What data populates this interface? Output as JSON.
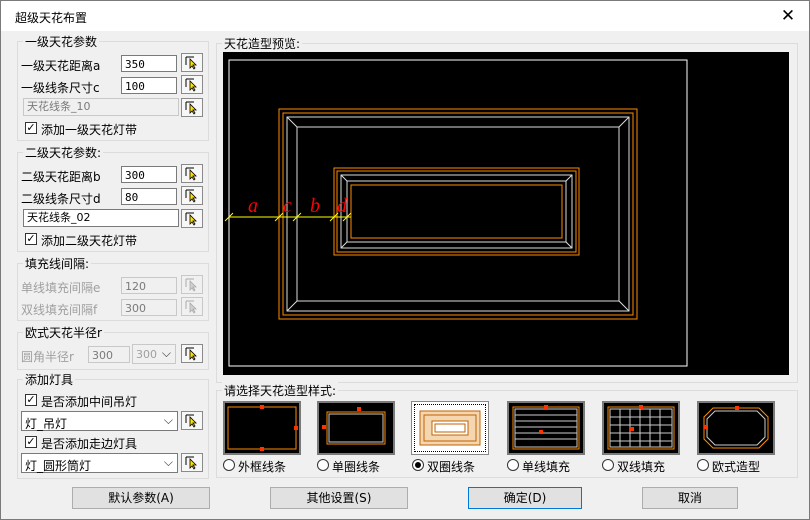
{
  "window": {
    "title": "超级天花布置",
    "close_glyph": "✕"
  },
  "level1": {
    "title": "一级天花参数",
    "distance_label": "一级天花距离a",
    "distance_value": "350",
    "size_label": "一级线条尺寸c",
    "size_value": "100",
    "line_style": "天花线条_10",
    "light_strip_label": "添加一级天花灯带",
    "light_strip_checked": true
  },
  "level2": {
    "title": "二级天花参数:",
    "distance_label": "二级天花距离b",
    "distance_value": "300",
    "size_label": "二级线条尺寸d",
    "size_value": "80",
    "line_style": "天花线条_02",
    "light_strip_label": "添加二级天花灯带",
    "light_strip_checked": true
  },
  "fill": {
    "title": "填充线间隔:",
    "single_label": "单线填充间隔e",
    "single_value": "120",
    "double_label": "双线填充间隔f",
    "double_value": "300"
  },
  "euro": {
    "title": "欧式天花半径r",
    "radius_label": "圆角半径r",
    "radius_value": "300",
    "radius_select": "300"
  },
  "lights": {
    "title": "添加灯具",
    "center_label": "是否添加中间吊灯",
    "center_checked": true,
    "center_lamp": "灯_吊灯",
    "side_label": "是否添加走边灯具",
    "side_checked": true,
    "side_lamp": "灯_圆形筒灯"
  },
  "preview": {
    "title": "天花造型预览:",
    "dim_labels": [
      "a",
      "c",
      "b",
      "d"
    ],
    "colors": {
      "outer": "#ffffff",
      "ceiling": "#ff8a00",
      "dim": "#ff0000",
      "tick": "#ffff00"
    }
  },
  "styles": {
    "title": "请选择天花造型样式:",
    "options": [
      {
        "label": "外框线条",
        "selected": false
      },
      {
        "label": "单圈线条",
        "selected": false
      },
      {
        "label": "双圈线条",
        "selected": true
      },
      {
        "label": "单线填充",
        "selected": false
      },
      {
        "label": "双线填充",
        "selected": false
      },
      {
        "label": "欧式造型",
        "selected": false
      }
    ]
  },
  "buttons": {
    "defaults": "默认参数(A)",
    "other": "其他设置(S)",
    "ok": "确定(D)",
    "cancel": "取消"
  }
}
